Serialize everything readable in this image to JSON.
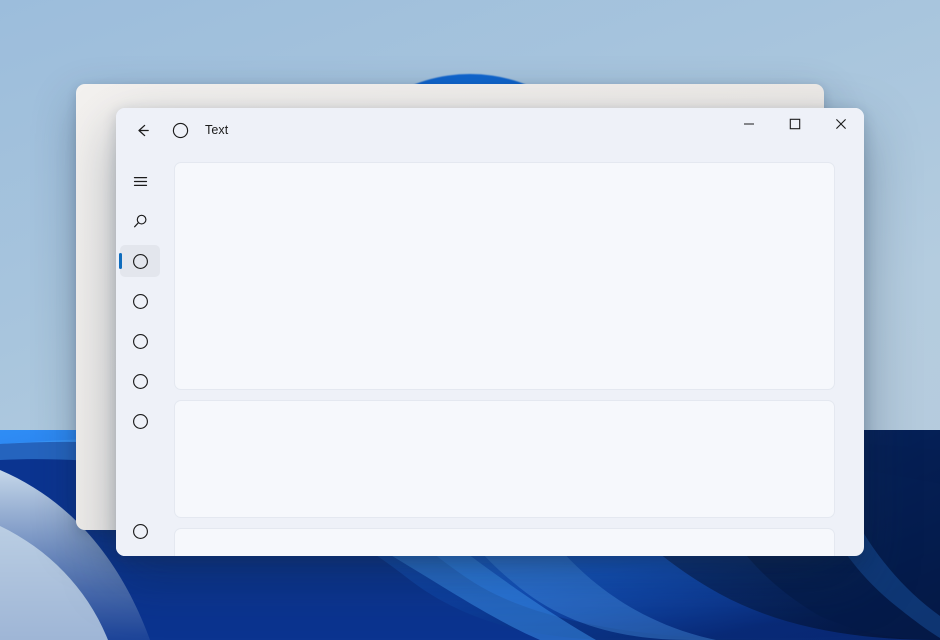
{
  "desktop": {
    "wallpaper_name": "windows-bloom-wallpaper",
    "colors": {
      "sky_top": "#9cbddc",
      "sky_bottom": "#b7cadb",
      "bloom_blue": "#1472dd",
      "bloom_deep": "#0a3a9e",
      "bloom_dark": "#071f54"
    }
  },
  "background_window": {
    "name": "inactive-window",
    "color": "#f1eeeb"
  },
  "app_window": {
    "titlebar": {
      "back_button": {
        "icon": "back-arrow-icon",
        "label": "Back"
      },
      "app_icon": "circle-icon",
      "title": "Text",
      "controls": {
        "minimize": {
          "icon": "minimize-icon",
          "label": "Minimize"
        },
        "maximize": {
          "icon": "maximize-icon",
          "label": "Maximize"
        },
        "close": {
          "icon": "close-icon",
          "label": "Close"
        }
      }
    },
    "navrail": {
      "items": [
        {
          "icon": "hamburger-menu-icon",
          "name": "nav-menu",
          "selected": false
        },
        {
          "icon": "search-icon",
          "name": "nav-search",
          "selected": false
        },
        {
          "icon": "circle-icon",
          "name": "nav-item-1",
          "selected": true
        },
        {
          "icon": "circle-icon",
          "name": "nav-item-2",
          "selected": false
        },
        {
          "icon": "circle-icon",
          "name": "nav-item-3",
          "selected": false
        },
        {
          "icon": "circle-icon",
          "name": "nav-item-4",
          "selected": false
        },
        {
          "icon": "circle-icon",
          "name": "nav-item-5",
          "selected": false
        }
      ],
      "bottom_item": {
        "icon": "circle-icon",
        "name": "nav-item-bottom",
        "selected": false
      },
      "selection_indicator_color": "#0f6cbd",
      "selection_background": "#e3e6ed"
    },
    "content": {
      "cards": [
        {
          "name": "content-card-1",
          "text": ""
        },
        {
          "name": "content-card-2",
          "text": ""
        },
        {
          "name": "content-card-3",
          "text": ""
        }
      ],
      "card_background": "#f6f8fc",
      "card_border": "#e4e8f0"
    },
    "surface_color": "#eef1f8"
  }
}
